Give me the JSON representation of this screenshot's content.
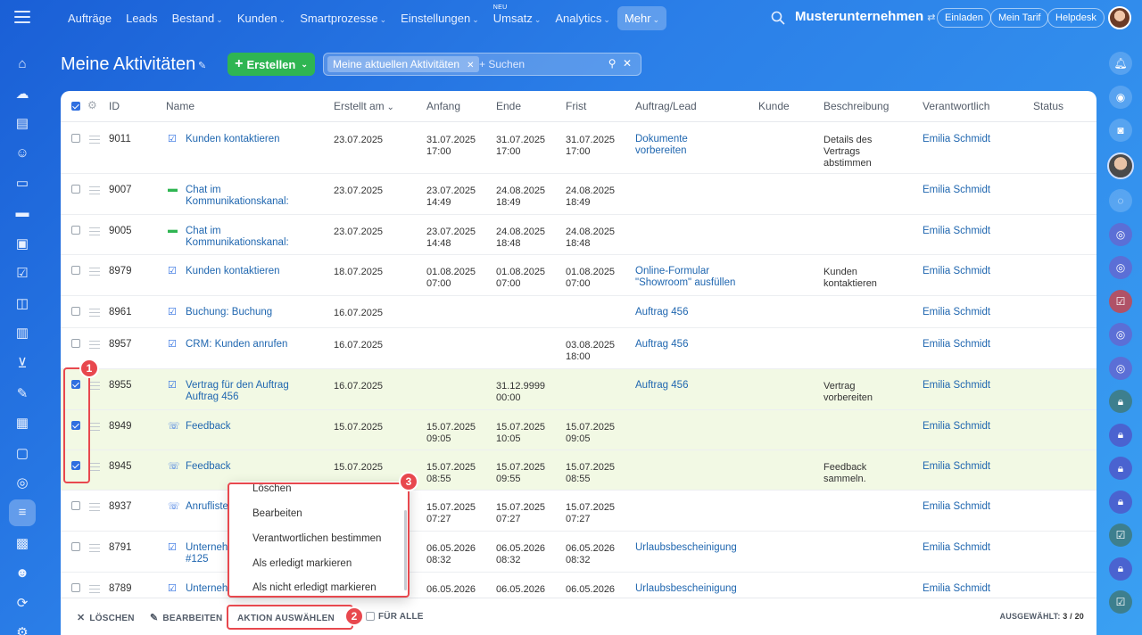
{
  "nav": {
    "items": [
      {
        "label": "Aufträge",
        "chev": false
      },
      {
        "label": "Leads",
        "chev": false
      },
      {
        "label": "Bestand",
        "chev": true
      },
      {
        "label": "Kunden",
        "chev": true
      },
      {
        "label": "Smartprozesse",
        "chev": true
      },
      {
        "label": "Einstellungen",
        "chev": true
      },
      {
        "label": "Umsatz",
        "chev": true,
        "badge": "NEU"
      },
      {
        "label": "Analytics",
        "chev": true
      },
      {
        "label": "Mehr",
        "chev": true,
        "active": true
      }
    ],
    "company": "Musterunternehmen",
    "buttons": [
      "Einladen",
      "Mein Tarif",
      "Helpdesk"
    ]
  },
  "header": {
    "title": "Meine Aktivitäten",
    "create_label": "Erstellen",
    "filter_tag": "Meine aktuellen Aktivitäten",
    "search_placeholder": "+ Suchen"
  },
  "table": {
    "columns": [
      "ID",
      "Name",
      "Erstellt am",
      "Anfang",
      "Ende",
      "Frist",
      "Auftrag/Lead",
      "Kunde",
      "Beschreibung",
      "Verantwortlich",
      "Status"
    ],
    "sort_column": "Erstellt am",
    "rows": [
      {
        "checked": false,
        "id": "9011",
        "type": "task",
        "name": [
          "Kunden kontaktieren"
        ],
        "created": "23.07.2025",
        "start": [
          "31.07.2025",
          "17:00"
        ],
        "end": [
          "31.07.2025",
          "17:00"
        ],
        "deadline": [
          "31.07.2025",
          "17:00"
        ],
        "deal": [
          "Dokumente",
          "vorbereiten"
        ],
        "desc": [
          "Details des",
          "Vertrags",
          "abstimmen"
        ],
        "resp": "Emilia Schmidt"
      },
      {
        "checked": false,
        "id": "9007",
        "type": "chat",
        "name": [
          "Chat im",
          "Kommunikationskanal:"
        ],
        "created": "23.07.2025",
        "start": [
          "23.07.2025",
          "14:49"
        ],
        "end": [
          "24.08.2025",
          "18:49"
        ],
        "deadline": [
          "24.08.2025",
          "18:49"
        ],
        "deal": [],
        "desc": [],
        "resp": "Emilia Schmidt"
      },
      {
        "checked": false,
        "id": "9005",
        "type": "chat",
        "name": [
          "Chat im",
          "Kommunikationskanal:"
        ],
        "created": "23.07.2025",
        "start": [
          "23.07.2025",
          "14:48"
        ],
        "end": [
          "24.08.2025",
          "18:48"
        ],
        "deadline": [
          "24.08.2025",
          "18:48"
        ],
        "deal": [],
        "desc": [],
        "resp": "Emilia Schmidt"
      },
      {
        "checked": false,
        "id": "8979",
        "type": "task",
        "name": [
          "Kunden kontaktieren"
        ],
        "created": "18.07.2025",
        "start": [
          "01.08.2025",
          "07:00"
        ],
        "end": [
          "01.08.2025",
          "07:00"
        ],
        "deadline": [
          "01.08.2025",
          "07:00"
        ],
        "deal": [
          "Online-Formular",
          "\"Showroom\" ausfüllen"
        ],
        "desc": [
          "Kunden",
          "kontaktieren"
        ],
        "resp": "Emilia Schmidt"
      },
      {
        "checked": false,
        "id": "8961",
        "type": "task",
        "name": [
          "Buchung: Buchung"
        ],
        "created": "16.07.2025",
        "start": [],
        "end": [],
        "deadline": [],
        "deal": [
          "Auftrag 456"
        ],
        "desc": [],
        "resp": "Emilia Schmidt"
      },
      {
        "checked": false,
        "id": "8957",
        "type": "task",
        "name": [
          "CRM: Kunden anrufen"
        ],
        "created": "16.07.2025",
        "start": [],
        "end": [],
        "deadline": [
          "03.08.2025",
          "18:00"
        ],
        "deal": [
          "Auftrag 456"
        ],
        "desc": [],
        "resp": "Emilia Schmidt"
      },
      {
        "checked": true,
        "id": "8955",
        "type": "task",
        "name": [
          "Vertrag für den Auftrag",
          "Auftrag 456"
        ],
        "created": "16.07.2025",
        "start": [],
        "end": [
          "31.12.9999",
          "00:00"
        ],
        "deadline": [],
        "deal": [
          "Auftrag 456"
        ],
        "desc": [
          "Vertrag",
          "vorbereiten"
        ],
        "resp": "Emilia Schmidt"
      },
      {
        "checked": true,
        "id": "8949",
        "type": "call",
        "name": [
          "Feedback"
        ],
        "created": "15.07.2025",
        "start": [
          "15.07.2025",
          "09:05"
        ],
        "end": [
          "15.07.2025",
          "10:05"
        ],
        "deadline": [
          "15.07.2025",
          "09:05"
        ],
        "deal": [],
        "desc": [],
        "resp": "Emilia Schmidt"
      },
      {
        "checked": true,
        "id": "8945",
        "type": "call",
        "name": [
          "Feedback"
        ],
        "created": "15.07.2025",
        "start": [
          "15.07.2025",
          "08:55"
        ],
        "end": [
          "15.07.2025",
          "09:55"
        ],
        "deadline": [
          "15.07.2025",
          "08:55"
        ],
        "deal": [],
        "desc": [
          "Feedback",
          "sammeln."
        ],
        "resp": "Emilia Schmidt"
      },
      {
        "checked": false,
        "id": "8937",
        "type": "call",
        "name": [
          "Anrufliste"
        ],
        "created": "",
        "start": [
          "15.07.2025",
          "07:27"
        ],
        "end": [
          "15.07.2025",
          "07:27"
        ],
        "deadline": [
          "15.07.2025",
          "07:27"
        ],
        "deal": [],
        "desc": [],
        "resp": "Emilia Schmidt"
      },
      {
        "checked": false,
        "id": "8791",
        "type": "task",
        "name": [
          "Unterneh",
          "#125"
        ],
        "created": "",
        "start": [
          "06.05.2026",
          "08:32"
        ],
        "end": [
          "06.05.2026",
          "08:32"
        ],
        "deadline": [
          "06.05.2026",
          "08:32"
        ],
        "deal": [
          "Urlaubsbescheinigung"
        ],
        "desc": [],
        "resp": "Emilia Schmidt"
      },
      {
        "checked": false,
        "id": "8789",
        "type": "task",
        "name": [
          "Unterneh"
        ],
        "created": "",
        "start": [
          "06.05.2026"
        ],
        "end": [
          "06.05.2026"
        ],
        "deadline": [
          "06.05.2026"
        ],
        "deal": [
          "Urlaubsbescheinigung"
        ],
        "desc": [],
        "resp": "Emilia Schmidt"
      }
    ]
  },
  "dropdown": {
    "items": [
      "Löschen",
      "Bearbeiten",
      "Verantwortlichen bestimmen",
      "Als erledigt markieren",
      "Als nicht erledigt markieren"
    ]
  },
  "bottom": {
    "delete_label": "LÖSCHEN",
    "edit_label": "BEARBEITEN",
    "action_label": "AKTION AUSWÄHLEN",
    "for_all_label": "FÜR ALLE",
    "selected_label": "AUSGEWÄHLT:",
    "selected_value": "3 / 20"
  },
  "annotations": [
    "1",
    "2",
    "3"
  ],
  "colors": {
    "accent": "#2f6fe0",
    "create_green": "#2fb552",
    "highlight_red": "#e8484e",
    "selected_row": "#f2f9e4",
    "link": "#2067b0"
  }
}
